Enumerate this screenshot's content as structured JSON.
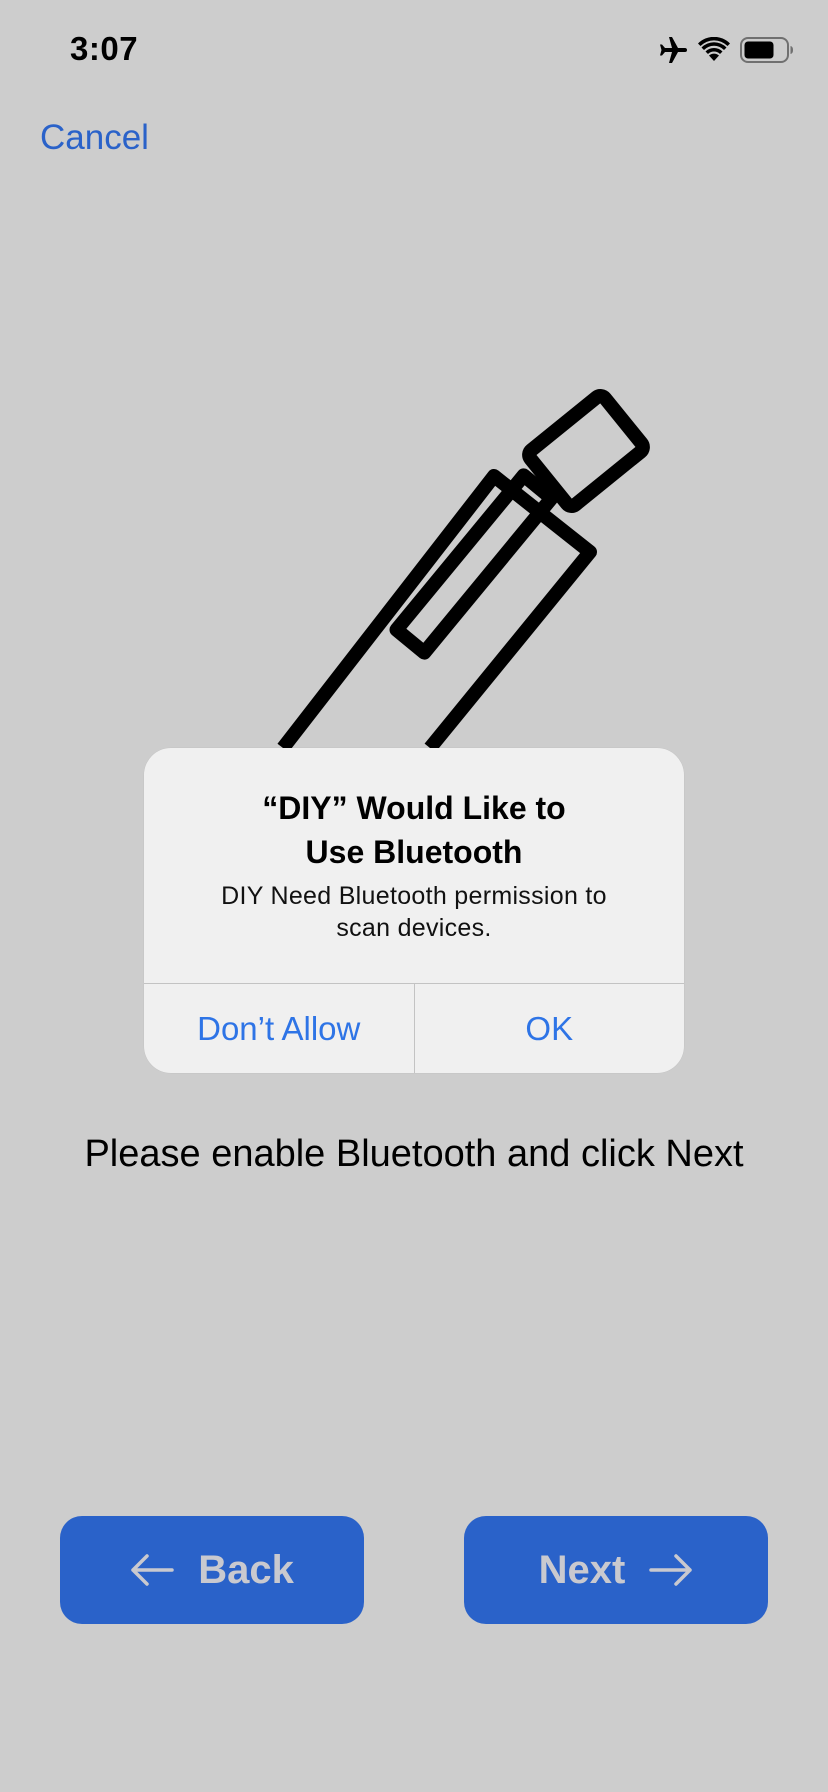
{
  "status_bar": {
    "time": "3:07",
    "icons": [
      "airplane-icon",
      "wifi-icon",
      "battery-icon"
    ]
  },
  "header": {
    "cancel_label": "Cancel"
  },
  "illustration": {
    "icon": "pen-device-icon"
  },
  "alert": {
    "title": "“DIY” Would Like to\nUse Bluetooth",
    "message": "DIY Need Bluetooth permission to\nscan devices.",
    "deny_label": "Don’t Allow",
    "ok_label": "OK"
  },
  "main": {
    "instruction": "Please enable Bluetooth and click Next"
  },
  "footer": {
    "back_label": "Back",
    "next_label": "Next"
  },
  "colors": {
    "background": "#cdcdcd",
    "accent": "#2a62c9",
    "alert_button_text": "#2e74e6",
    "nav_button_text": "#c9c9cf"
  }
}
